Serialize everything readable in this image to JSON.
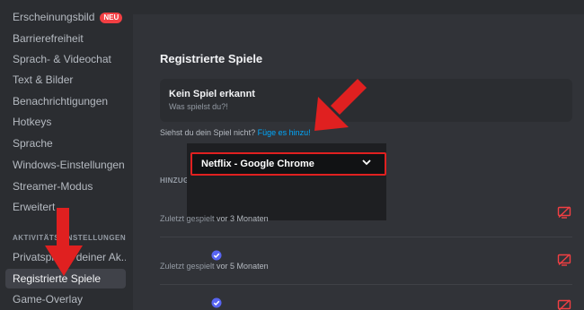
{
  "sidebar": {
    "items": [
      {
        "label": "Erscheinungsbild",
        "badge": "NEU"
      },
      {
        "label": "Barrierefreiheit"
      },
      {
        "label": "Sprach- & Videochat"
      },
      {
        "label": "Text & Bilder"
      },
      {
        "label": "Benachrichtigungen"
      },
      {
        "label": "Hotkeys"
      },
      {
        "label": "Sprache"
      },
      {
        "label": "Windows-Einstellungen"
      },
      {
        "label": "Streamer-Modus"
      },
      {
        "label": "Erweitert"
      }
    ],
    "section_heading": "AKTIVITÄTSEINSTELLUNGEN",
    "activity_items": [
      {
        "label": "Privatsphäre deiner Ak..."
      },
      {
        "label": "Registrierte Spiele",
        "active": true
      },
      {
        "label": "Game-Overlay"
      }
    ]
  },
  "main": {
    "title": "Registrierte Spiele",
    "card": {
      "title": "Kein Spiel erkannt",
      "subtitle": "Was spielst du?!"
    },
    "hint": {
      "text": "Siehst du dein Spiel nicht?",
      "link": "Füge es hinzu!"
    },
    "dropdown": {
      "value": "Netflix - Google Chrome"
    },
    "section_label": "HINZUG",
    "rows": [
      {
        "prefix": "Zuletzt gespielt",
        "suffix": "vor 3 Monaten"
      },
      {
        "prefix": "Zuletzt gespielt",
        "suffix": "vor 5 Monaten"
      }
    ]
  },
  "colors": {
    "accent_link": "#00a8fc",
    "annotation_red": "#e02020",
    "badge_red": "#f23f43",
    "verified_blue": "#5865f2",
    "danger_icon": "#f23f43"
  }
}
